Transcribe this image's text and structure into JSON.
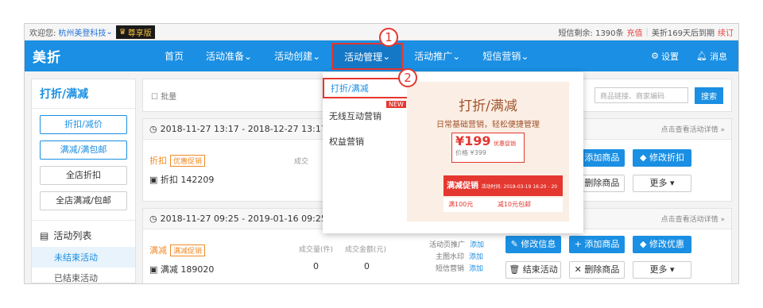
{
  "topbar": {
    "welcome": "欢迎您:",
    "shop": "杭州美登科技",
    "vip": "尊享版",
    "sms": "短信剩余: 1390条",
    "recharge": "充值",
    "expire": "美折169天后到期",
    "renew": "续订"
  },
  "nav": {
    "logo": "美折",
    "items": [
      "首页",
      "活动准备",
      "活动创建",
      "活动管理",
      "活动推广",
      "短信营销"
    ],
    "settings": "设置",
    "messages": "消息"
  },
  "sidebar": {
    "title": "打折/满减",
    "buttons": [
      "折扣/减价",
      "满减/满包邮",
      "全店折扣",
      "全店满减/包邮"
    ],
    "list_title": "活动列表",
    "links": [
      "未结束活动",
      "已结束活动"
    ]
  },
  "toolbar": {
    "batch": "批量",
    "search_placeholder": "商品链接、商家编码",
    "search_btn": "搜索"
  },
  "cards": [
    {
      "period": "2018-11-27 13:17 - 2018-12-27 13:17",
      "detail": "点击查看活动详情 »",
      "type": "折扣",
      "badge": "优惠促销",
      "id": "折扣 142209",
      "stat_label": "成交",
      "buttons": [
        "添加商品",
        "修改折扣",
        "删除商品",
        "更多"
      ]
    },
    {
      "period": "2018-11-27 09:25 - 2019-01-16 09:25",
      "detail": "点击查看活动详情 »",
      "type": "满减",
      "badge": "满减促销",
      "id": "满减 189020",
      "stat_labels": [
        "成交量(件)",
        "成交金额(元)"
      ],
      "stat_values": [
        "0",
        "0"
      ],
      "promos": [
        "活动页推广",
        "主图水印",
        "短信营销"
      ],
      "promo_add": "添加",
      "buttons": [
        "修改信息",
        "添加商品",
        "修改优惠",
        "结束活动",
        "删除商品",
        "更多"
      ]
    }
  ],
  "dropdown": {
    "items": [
      "打折/满减",
      "无线互动营销",
      "权益营销"
    ],
    "new_tag": "NEW",
    "promo_title": "打折/满减",
    "promo_sub": "日常基础营销，轻松便捷管理",
    "price": "¥199",
    "price_tag": "优惠促销",
    "orig_price": "价格 ¥399",
    "banner": "满减促销",
    "banner_time": "活动时间: 2018-03-19 16:20 - 20",
    "deal1": "满100元",
    "deal2": "减10元包邮"
  },
  "callouts": [
    "1",
    "2"
  ]
}
